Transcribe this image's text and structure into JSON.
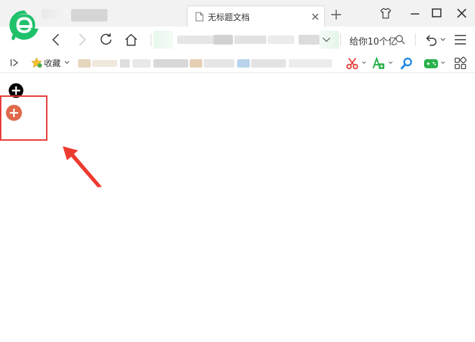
{
  "window": {
    "tab": {
      "title": "无标题文档",
      "icon": "document-icon",
      "close_icon": "close-icon"
    },
    "new_tab_icon": "plus-icon",
    "controls": [
      "skin-shirt-icon",
      "minimize-icon",
      "maximize-icon",
      "close-window-icon"
    ]
  },
  "navigation": {
    "buttons": [
      "back-icon",
      "forward-icon",
      "reload-icon",
      "home-icon"
    ],
    "address_dropdown_icon": "chevron-down-icon",
    "search": {
      "text": "给你10个亿",
      "icon": "search-icon"
    },
    "undo_icon": "undo-icon",
    "menu_icon": "hamburger-menu-icon"
  },
  "bookmarks": {
    "toggle_icon": "sidebar-toggle-icon",
    "favorites_label": "收藏",
    "tools": [
      "scissors-icon",
      "translate-icon",
      "magnifier-icon",
      "gamepad-icon",
      "apps-grid-icon"
    ]
  },
  "colors": {
    "logo_green": "#1fc16b",
    "scissors_red": "#e53935",
    "tool_green": "#2bb24c",
    "search_blue": "#1e88e5",
    "plus_orange": "#e0694a",
    "highlight_red": "#e53935"
  },
  "content": {
    "icons": [
      "plus-circle-black-icon",
      "plus-circle-orange-icon"
    ],
    "annotation": {
      "highlight": "red-rectangle",
      "arrow": "red-arrow"
    }
  }
}
